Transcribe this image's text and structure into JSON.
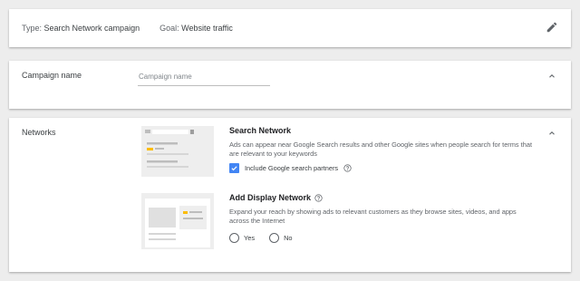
{
  "summary": {
    "type_label": "Type:",
    "type_value": "Search Network campaign",
    "goal_label": "Goal:",
    "goal_value": "Website traffic"
  },
  "campaign_name": {
    "label": "Campaign name",
    "placeholder": "Campaign name",
    "value": ""
  },
  "networks": {
    "label": "Networks",
    "search": {
      "title": "Search Network",
      "description": "Ads can appear near Google Search results and other Google sites when people search for terms that are relevant to your keywords",
      "include_partners_label": "Include Google search partners",
      "include_partners_checked": true
    },
    "display": {
      "title": "Add Display Network",
      "description": "Expand your reach by showing ads to relevant customers as they browse sites, videos, and apps across the Internet",
      "options": [
        "Yes",
        "No"
      ],
      "selected": ""
    }
  },
  "colors": {
    "accent_blue": "#4285f4",
    "highlight_yellow": "#fbbc04",
    "background": "#ededed"
  }
}
